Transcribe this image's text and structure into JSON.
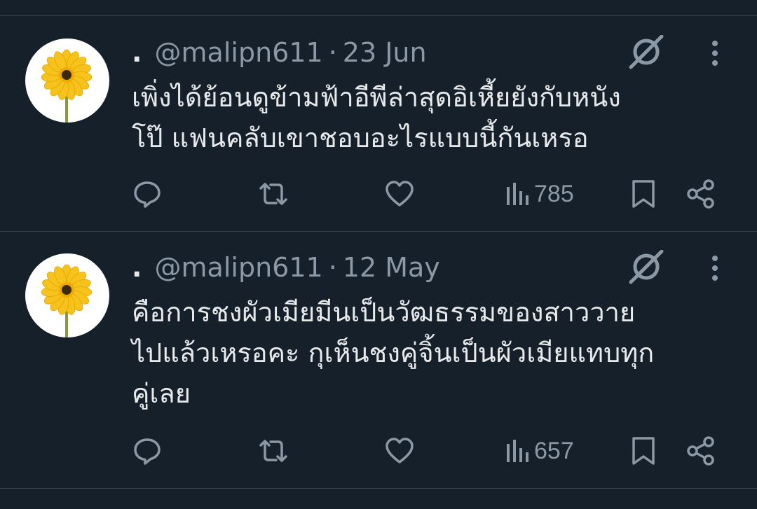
{
  "colors": {
    "background": "#15202b",
    "divider": "#38444d",
    "text_primary": "#e7e9ea",
    "text_secondary": "#8b98a5",
    "avatar_petal": "#f6c21b",
    "avatar_center": "#3a2a0a",
    "avatar_stem": "#8a9a3a"
  },
  "tweets": [
    {
      "author_prefix": ".",
      "handle": "@malipn611",
      "separator": "·",
      "date": "23 Jun",
      "text": "เพิ่งได้ย้อนดูข้ามฟ้าอีพีล่าสุดอิเหี้ยยังกับหนัง\nโป๊ แฟนคลับเขาชอบอะไรแบบนี้กันเหรอ",
      "views": "785",
      "icons": {
        "avatar": "sunflower-avatar",
        "grok": "grok-icon",
        "more": "more-icon",
        "reply": "reply-icon",
        "retweet": "retweet-icon",
        "like": "heart-icon",
        "views": "views-icon",
        "bookmark": "bookmark-icon",
        "share": "share-icon"
      }
    },
    {
      "author_prefix": ".",
      "handle": "@malipn611",
      "separator": "·",
      "date": "12 May",
      "text": "คือการชงผัวเมียมีนเป็นวัฒธรรมของสาววาย\nไปแล้วเหรอคะ กุเห็นชงคู่จิ้นเป็นผัวเมียแทบทุก\nคู่เลย",
      "views": "657",
      "icons": {
        "avatar": "sunflower-avatar",
        "grok": "grok-icon",
        "more": "more-icon",
        "reply": "reply-icon",
        "retweet": "retweet-icon",
        "like": "heart-icon",
        "views": "views-icon",
        "bookmark": "bookmark-icon",
        "share": "share-icon"
      }
    }
  ]
}
